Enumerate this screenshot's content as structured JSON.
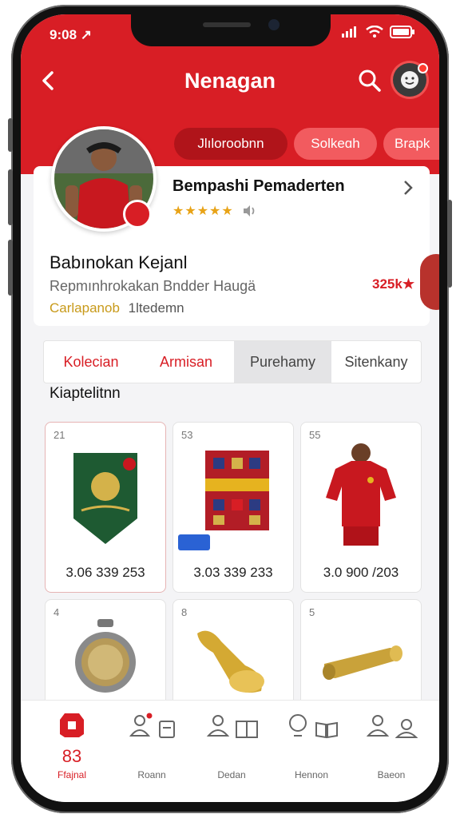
{
  "status": {
    "time": "9:08 ↗"
  },
  "header": {
    "title": "Nenagan"
  },
  "chips": [
    "Jlıloroobnn",
    "Solkeɑh",
    "Brapk"
  ],
  "profile": {
    "name": "Bempashi Pemaderten",
    "stars": "★★★★★",
    "section_title": "Babınokan Kejanl",
    "subtitle": "Repmınhrokakan Bndder Haugä",
    "tag": "Carlapanob",
    "tag_rest": "1ltedemn",
    "score": "325k★"
  },
  "tabs": [
    "Kolecian",
    "Armisan",
    "Purehamy",
    "Sitenkany"
  ],
  "list_heading": "Kiaptelitnn",
  "items": [
    {
      "num": "21",
      "price": "3.06 339 253",
      "icon": "pennant-icon"
    },
    {
      "num": "53",
      "price": "3.03 339 233",
      "icon": "scarf-icon"
    },
    {
      "num": "55",
      "price": "3.0 900 /203",
      "icon": "jersey-icon"
    },
    {
      "num": "4",
      "price": "",
      "icon": "medal-icon"
    },
    {
      "num": "8",
      "price": "",
      "icon": "trophy-icon"
    },
    {
      "num": "5",
      "price": "",
      "icon": "scroll-icon"
    }
  ],
  "nav": [
    {
      "label": "Ffajnal",
      "count": "83"
    },
    {
      "label": "Roann"
    },
    {
      "label": "Dedan"
    },
    {
      "label": "Hennon"
    },
    {
      "label": "Baeon"
    }
  ],
  "colors": {
    "brand": "#d81e25",
    "gold": "#c89a1a"
  }
}
